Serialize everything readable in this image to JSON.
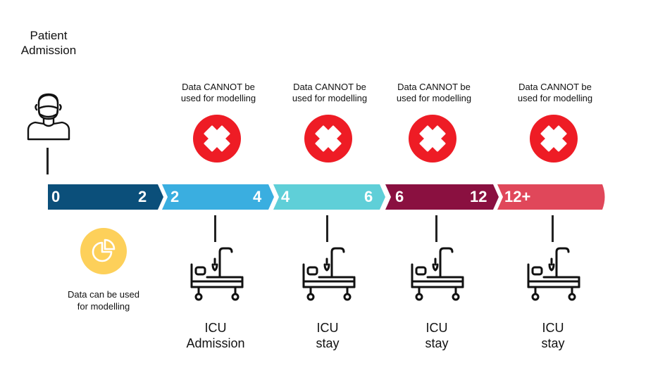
{
  "patient": {
    "label_line1": "Patient",
    "label_line2": "Admission",
    "icon": "patient-icon"
  },
  "warning": {
    "line1": "Data CANNOT  be",
    "line2": "used for modelling",
    "icon": "red-x-icon"
  },
  "timeline": {
    "segments": [
      {
        "start": "0",
        "end": "2",
        "color": "#0b4f7a"
      },
      {
        "start": "2",
        "end": "4",
        "color": "#3aaee0"
      },
      {
        "start": "4",
        "end": "6",
        "color": "#5fcfd8"
      },
      {
        "start": "6",
        "end": "12",
        "color": "#8a1040"
      },
      {
        "start": "12+",
        "end": "",
        "color": "#e0475a"
      }
    ]
  },
  "usable": {
    "line1": "Data can be used",
    "line2": "for modelling",
    "icon": "pie-chart-icon",
    "color": "#fdd05a"
  },
  "locations": [
    {
      "line1": "ICU",
      "line2": "Admission",
      "icon": "hospital-bed-icon"
    },
    {
      "line1": "ICU",
      "line2": "stay",
      "icon": "hospital-bed-icon"
    },
    {
      "line1": "ICU",
      "line2": "stay",
      "icon": "hospital-bed-icon"
    },
    {
      "line1": "ICU",
      "line2": "stay",
      "icon": "hospital-bed-icon"
    }
  ]
}
